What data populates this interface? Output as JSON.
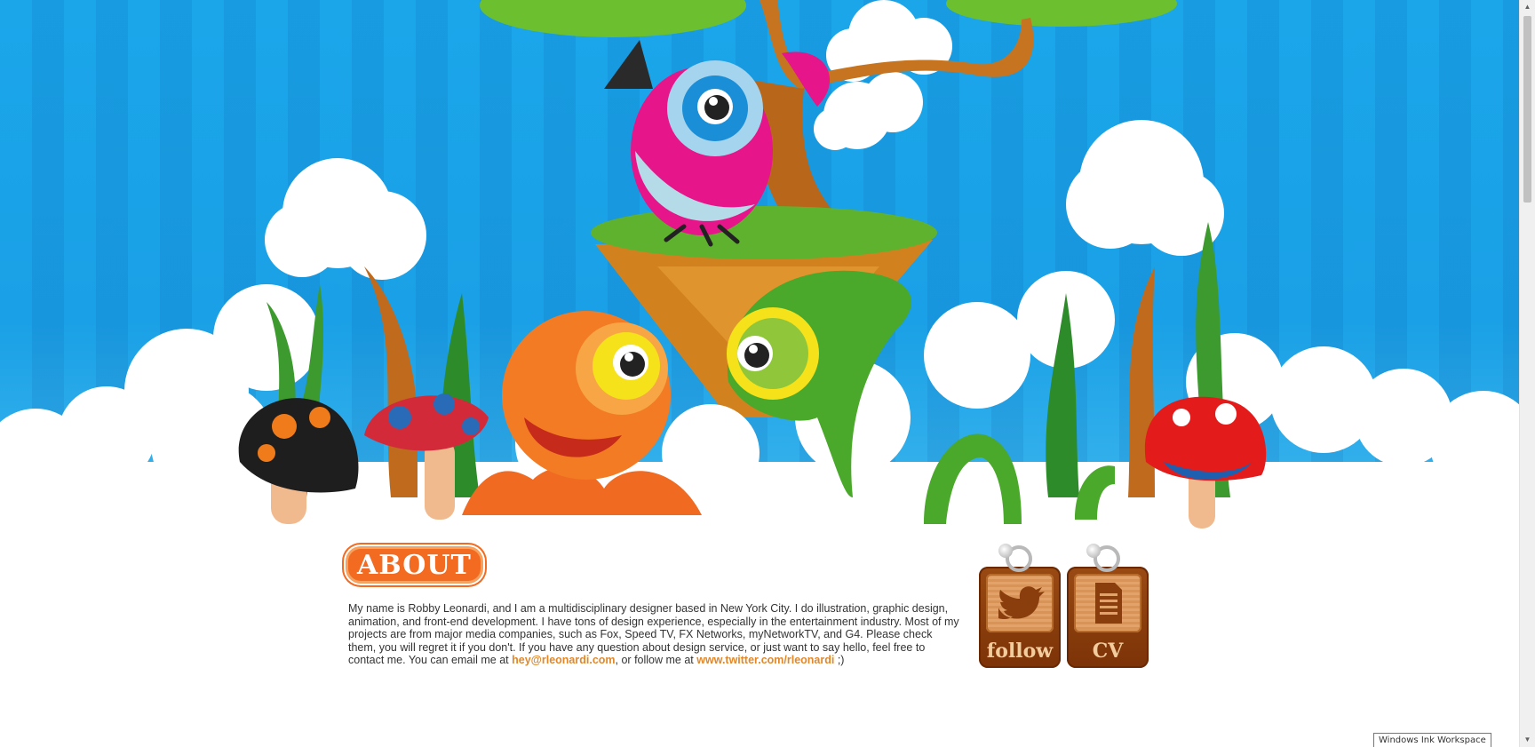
{
  "about": {
    "title": "ABOUT",
    "text_intro": "My name is Robby Leonardi, and I am a multidisciplinary designer based in New York City. I do illustration, graphic design, animation, and front-end development. I have tons of design experience, especially in the entertainment industry. Most of my projects are from major media companies, such as Fox, Speed TV, FX Networks, myNetworkTV, and G4. Please check them, you will regret it if you don't. If you have any question about design service, or just want to say hello, feel free to contact me. You can email me at ",
    "email": "hey@rleonardi.com",
    "text_middle": ", or follow me at ",
    "twitter": "www.twitter.com/rleonardi",
    "text_end": " ;)"
  },
  "buttons": {
    "follow_label": "follow",
    "cv_label": "CV"
  },
  "system": {
    "tooltip": "Windows Ink Workspace"
  },
  "colors": {
    "sky": "#1ba6ea",
    "accent_orange": "#f26b21",
    "link": "#e1882a",
    "wood": "#8a3e0d"
  },
  "icons": {
    "follow": "twitter-bird-icon",
    "cv": "document-icon"
  }
}
